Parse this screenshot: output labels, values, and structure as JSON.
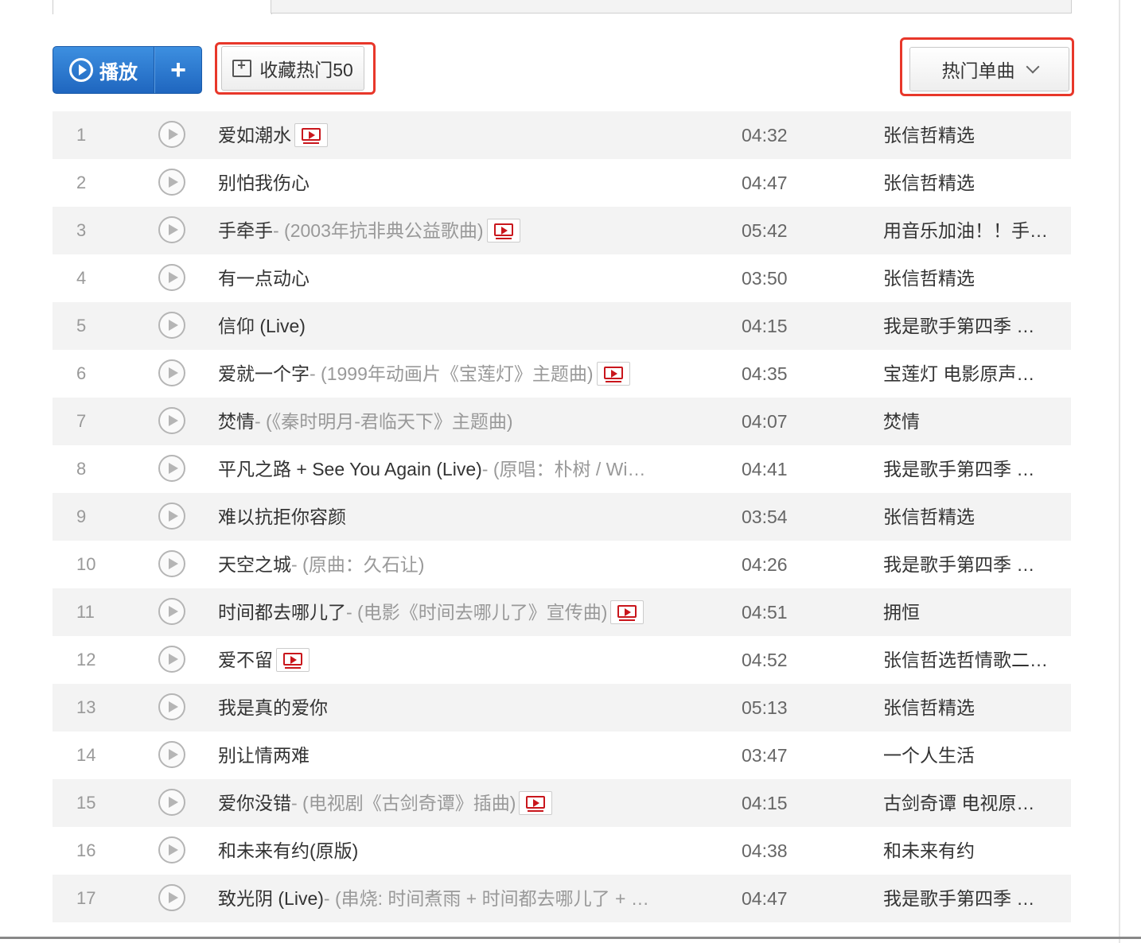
{
  "toolbar": {
    "play_label": "播放",
    "add_label": "+",
    "collect_label": "收藏热门50",
    "sort_label": "热门单曲"
  },
  "colors": {
    "play_button": "#2a78d4",
    "highlight": "#e8372a",
    "mv_icon": "#c9161c",
    "stripe": "#f3f3f3"
  },
  "songs": [
    {
      "index": "1",
      "title": "爱如潮水",
      "sub": "",
      "mv": true,
      "duration": "04:32",
      "album": "张信哲精选"
    },
    {
      "index": "2",
      "title": "别怕我伤心",
      "sub": "",
      "mv": false,
      "duration": "04:47",
      "album": "张信哲精选"
    },
    {
      "index": "3",
      "title": "手牵手",
      "sub": " - (2003年抗非典公益歌曲)",
      "mv": true,
      "duration": "05:42",
      "album": "用音乐加油！！手…"
    },
    {
      "index": "4",
      "title": "有一点动心",
      "sub": "",
      "mv": false,
      "duration": "03:50",
      "album": "张信哲精选"
    },
    {
      "index": "5",
      "title": "信仰 (Live)",
      "sub": "",
      "mv": false,
      "duration": "04:15",
      "album": "我是歌手第四季 …"
    },
    {
      "index": "6",
      "title": "爱就一个字",
      "sub": " - (1999年动画片《宝莲灯》主题曲)",
      "mv": true,
      "duration": "04:35",
      "album": "宝莲灯 电影原声…"
    },
    {
      "index": "7",
      "title": "焚情",
      "sub": " - (《秦时明月-君临天下》主题曲)",
      "mv": false,
      "duration": "04:07",
      "album": "焚情"
    },
    {
      "index": "8",
      "title": "平凡之路 + See You Again (Live)",
      "sub": " - (原唱：朴树 / Wi…",
      "mv": false,
      "duration": "04:41",
      "album": "我是歌手第四季 …"
    },
    {
      "index": "9",
      "title": "难以抗拒你容颜",
      "sub": "",
      "mv": false,
      "duration": "03:54",
      "album": "张信哲精选"
    },
    {
      "index": "10",
      "title": "天空之城",
      "sub": " - (原曲：久石让)",
      "mv": false,
      "duration": "04:26",
      "album": "我是歌手第四季 …"
    },
    {
      "index": "11",
      "title": "时间都去哪儿了",
      "sub": " - (电影《时间去哪儿了》宣传曲)",
      "mv": true,
      "duration": "04:51",
      "album": "拥恒"
    },
    {
      "index": "12",
      "title": "爱不留",
      "sub": "",
      "mv": true,
      "duration": "04:52",
      "album": "张信哲选哲情歌二…"
    },
    {
      "index": "13",
      "title": "我是真的爱你",
      "sub": "",
      "mv": false,
      "duration": "05:13",
      "album": "张信哲精选"
    },
    {
      "index": "14",
      "title": "别让情两难",
      "sub": "",
      "mv": false,
      "duration": "03:47",
      "album": "一个人生活"
    },
    {
      "index": "15",
      "title": "爱你没错",
      "sub": " - (电视剧《古剑奇谭》插曲)",
      "mv": true,
      "duration": "04:15",
      "album": "古剑奇谭 电视原…"
    },
    {
      "index": "16",
      "title": "和未来有约(原版)",
      "sub": "",
      "mv": false,
      "duration": "04:38",
      "album": "和未来有约"
    },
    {
      "index": "17",
      "title": "致光阴 (Live)",
      "sub": " - (串烧: 时间煮雨 + 时间都去哪儿了 + …",
      "mv": false,
      "duration": "04:47",
      "album": "我是歌手第四季 …"
    }
  ]
}
